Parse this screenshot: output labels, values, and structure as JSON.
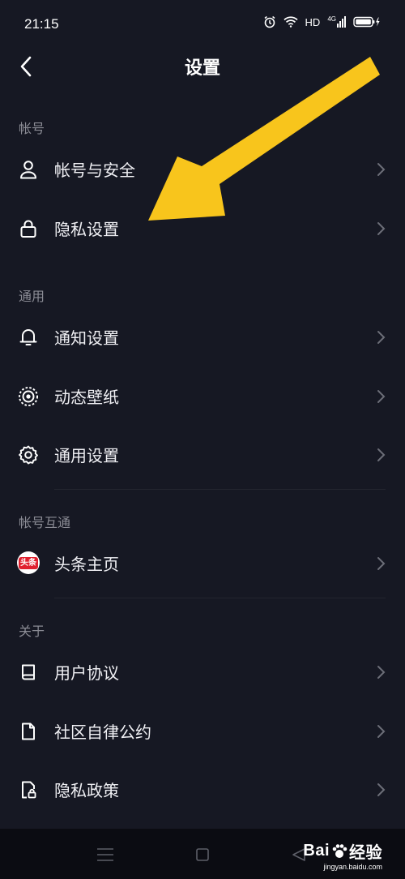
{
  "status": {
    "time": "21:15",
    "hd": "HD",
    "signal": "4G"
  },
  "header": {
    "title": "设置"
  },
  "sections": [
    {
      "label": "帐号",
      "items": [
        {
          "label": "帐号与安全",
          "icon": "user-icon"
        },
        {
          "label": "隐私设置",
          "icon": "lock-icon"
        }
      ]
    },
    {
      "label": "通用",
      "items": [
        {
          "label": "通知设置",
          "icon": "bell-icon"
        },
        {
          "label": "动态壁纸",
          "icon": "live-wallpaper-icon"
        },
        {
          "label": "通用设置",
          "icon": "gear-icon"
        }
      ]
    },
    {
      "label": "帐号互通",
      "items": [
        {
          "label": "头条主页",
          "icon": "toutiao-logo-icon",
          "badge": "头条"
        }
      ]
    },
    {
      "label": "关于",
      "items": [
        {
          "label": "用户协议",
          "icon": "book-icon"
        },
        {
          "label": "社区自律公约",
          "icon": "document-icon"
        },
        {
          "label": "隐私政策",
          "icon": "privacy-doc-icon"
        }
      ]
    }
  ],
  "watermark": {
    "brand": "Bai",
    "suffix": "经验",
    "url": "jingyan.baidu.com"
  },
  "colors": {
    "background": "#161823",
    "arrow": "#f8c51c",
    "toutiao_red": "#e0202f"
  }
}
